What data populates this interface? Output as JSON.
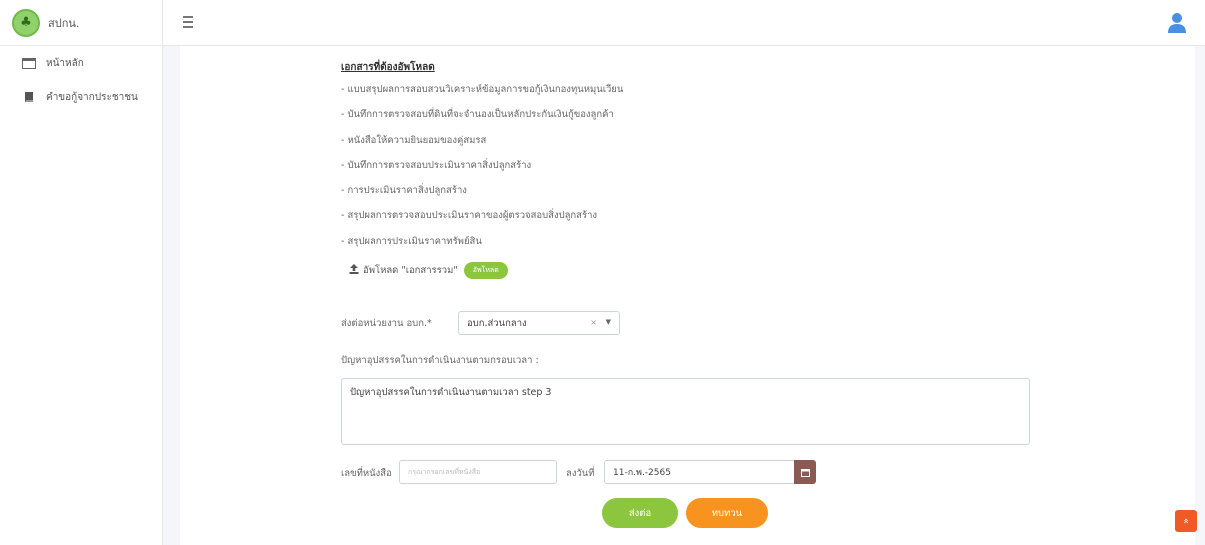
{
  "brand": {
    "name": "สปกน."
  },
  "sidebar": {
    "items": [
      {
        "label": "หน้าหลัก",
        "icon": "window-icon"
      },
      {
        "label": "คำขอกู้จากประชาชน",
        "icon": "book-icon"
      }
    ]
  },
  "documents": {
    "title": "เอกสารที่ต้องอัพโหลด",
    "items": [
      "- แบบสรุปผลการสอบสวนวิเคราะห์ข้อมูลการขอกู้เงินกองทุนหมุนเวียน",
      "- บันทึกการตรวจสอบที่ดินที่จะจำนองเป็นหลักประกันเงินกู้ของลูกค้า",
      "- หนังสือให้ความยินยอมของคู่สมรส",
      "- บันทึกการตรวจสอบประเมินราคาสิ่งปลูกสร้าง",
      "- การประเมินราคาสิ่งปลูกสร้าง",
      "- สรุปผลการตรวจสอบประเมินราคาของผู้ตรวจสอบสิ่งปลูกสร้าง",
      "- สรุปผลการประเมินราคาทรัพย์สิน"
    ]
  },
  "upload": {
    "label": "อัพโหลด \"เอกสารรวม\"",
    "button": "อัพโหลด"
  },
  "forward": {
    "label": "ส่งต่อหน่วยงาน อบก.*",
    "selected": "อบก.ส่วนกลาง",
    "clear": "×",
    "arrow": "▼"
  },
  "problem": {
    "label": "ปัญหาอุปสรรคในการดำเนินงานตามกรอบเวลา :",
    "value": "ปัญหาอุปสรรคในการดำเนินงานตามเวลา step 3"
  },
  "doc_number": {
    "label": "เลขที่หนังสือ",
    "placeholder": "กรุณากรอกเลขที่หนังสือ"
  },
  "date": {
    "label": "ลงวันที่",
    "value": "11-ก.พ.-2565"
  },
  "actions": {
    "send": "ส่งต่อ",
    "back": "ทบทวน"
  },
  "scroll_top": "»",
  "colors": {
    "green": "#8cc63f",
    "orange": "#f7931e",
    "calendar": "#8b5a52",
    "scroll": "#f15a24"
  }
}
